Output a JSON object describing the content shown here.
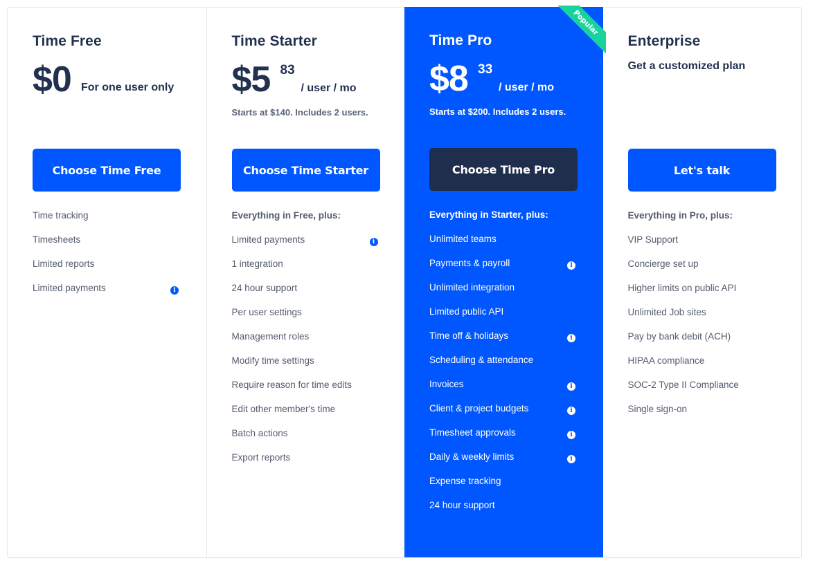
{
  "accent_color": "#0057ff",
  "featured_bg": "#0057ff",
  "dark_button_color": "#1f2e4d",
  "badge_color": "#19d39a",
  "plans": [
    {
      "name": "Time Free",
      "price_main": "$0",
      "price_note": "For one user only",
      "cta_label": "Choose Time Free",
      "features": [
        {
          "label": "Time tracking",
          "info": false
        },
        {
          "label": "Timesheets",
          "info": false
        },
        {
          "label": "Limited reports",
          "info": false
        },
        {
          "label": "Limited payments",
          "info": true
        }
      ]
    },
    {
      "name": "Time Starter",
      "price_main": "$5",
      "price_cents": "83",
      "price_unit": "/ user / mo",
      "starts_note": "Starts at $140. Includes 2 users.",
      "cta_label": "Choose Time Starter",
      "features_lead": "Everything in Free, plus:",
      "features": [
        {
          "label": "Limited payments",
          "info": true
        },
        {
          "label": "1 integration",
          "info": false
        },
        {
          "label": "24 hour support",
          "info": false
        },
        {
          "label": "Per user settings",
          "info": false
        },
        {
          "label": "Management roles",
          "info": false
        },
        {
          "label": "Modify time settings",
          "info": false
        },
        {
          "label": "Require reason for time edits",
          "info": false
        },
        {
          "label": "Edit other member's time",
          "info": false
        },
        {
          "label": "Batch actions",
          "info": false
        },
        {
          "label": "Export reports",
          "info": false
        }
      ]
    },
    {
      "name": "Time Pro",
      "badge": "Popular",
      "price_main": "$8",
      "price_cents": "33",
      "price_unit": "/ user / mo",
      "starts_note": "Starts at $200. Includes 2 users.",
      "cta_label": "Choose Time Pro",
      "features_lead": "Everything in Starter, plus:",
      "features": [
        {
          "label": "Unlimited teams",
          "info": false
        },
        {
          "label": "Payments & payroll",
          "info": true
        },
        {
          "label": "Unlimited integration",
          "info": false
        },
        {
          "label": "Limited public API",
          "info": false
        },
        {
          "label": "Time off & holidays",
          "info": true
        },
        {
          "label": "Scheduling & attendance",
          "info": false
        },
        {
          "label": "Invoices",
          "info": true
        },
        {
          "label": "Client & project budgets",
          "info": true
        },
        {
          "label": "Timesheet approvals",
          "info": true
        },
        {
          "label": "Daily & weekly limits",
          "info": true
        },
        {
          "label": "Expense tracking",
          "info": false
        },
        {
          "label": "24 hour support",
          "info": false
        }
      ]
    },
    {
      "name": "Enterprise",
      "subtitle": "Get a customized plan",
      "cta_label": "Let's talk",
      "features_lead": "Everything in Pro, plus:",
      "features": [
        {
          "label": "VIP Support",
          "info": false
        },
        {
          "label": "Concierge set up",
          "info": false
        },
        {
          "label": "Higher limits on public API",
          "info": false
        },
        {
          "label": "Unlimited Job sites",
          "info": false
        },
        {
          "label": "Pay by bank debit (ACH)",
          "info": false
        },
        {
          "label": "HIPAA compliance",
          "info": false
        },
        {
          "label": "SOC-2 Type II Compliance",
          "info": false
        },
        {
          "label": "Single sign-on",
          "info": false
        }
      ]
    }
  ],
  "info_icon": "info-circle-icon"
}
